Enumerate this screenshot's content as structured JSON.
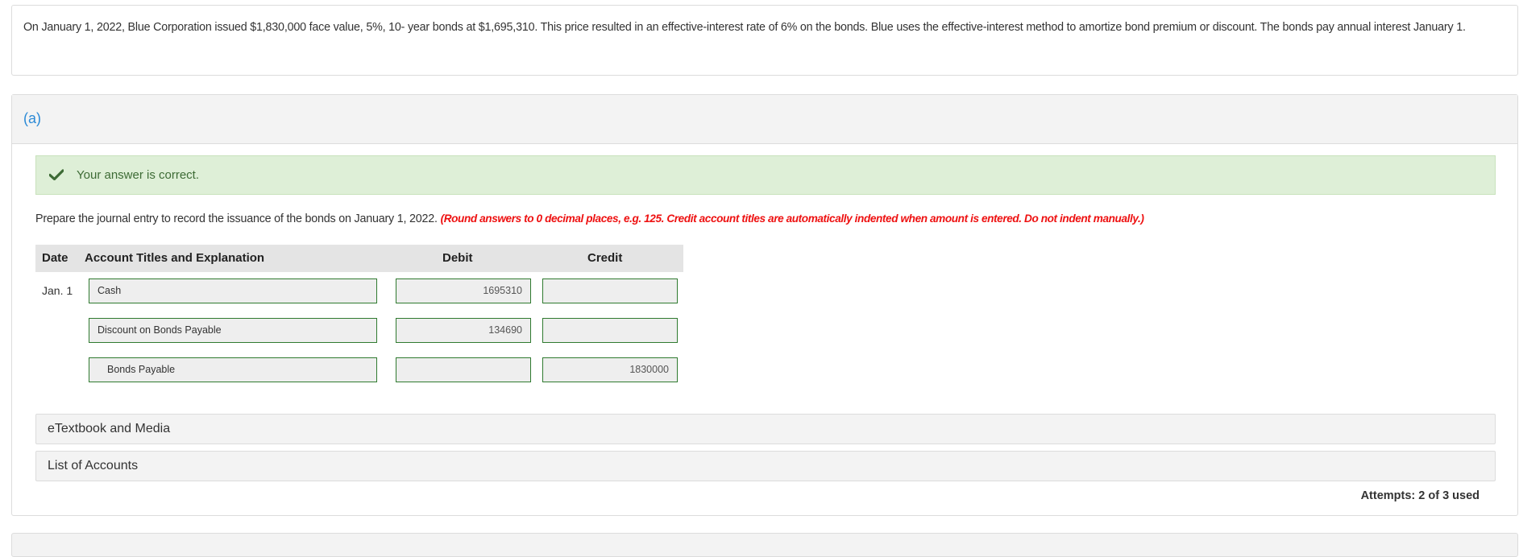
{
  "question": {
    "text": "On January 1, 2022, Blue Corporation issued $1,830,000 face value, 5%, 10- year bonds at $1,695,310. This price resulted in an effective-interest rate of 6% on the bonds. Blue uses the effective-interest method to amortize bond premium or discount. The bonds pay annual interest January 1."
  },
  "part": {
    "label": "(a)",
    "feedback": {
      "icon": "check-icon",
      "text": "Your answer is correct.",
      "color": "#3d6b35",
      "background": "#deefd7"
    },
    "prompt": "Prepare the journal entry to record the issuance of the bonds on January 1, 2022.",
    "note": "(Round answers to 0 decimal places, e.g. 125. Credit account titles are automatically indented when amount is entered. Do not indent manually.)",
    "table": {
      "headers": {
        "date": "Date",
        "account": "Account Titles and Explanation",
        "debit": "Debit",
        "credit": "Credit"
      },
      "rows": [
        {
          "date": "Jan. 1",
          "account": "Cash",
          "debit": "1695310",
          "credit": ""
        },
        {
          "date": "",
          "account": "Discount on Bonds Payable",
          "debit": "134690",
          "credit": ""
        },
        {
          "date": "",
          "account": "Bonds Payable",
          "debit": "",
          "credit": "1830000"
        }
      ]
    },
    "links": {
      "etextbook": "eTextbook and Media",
      "accounts": "List of Accounts"
    },
    "attempts": "Attempts: 2 of 3 used"
  }
}
